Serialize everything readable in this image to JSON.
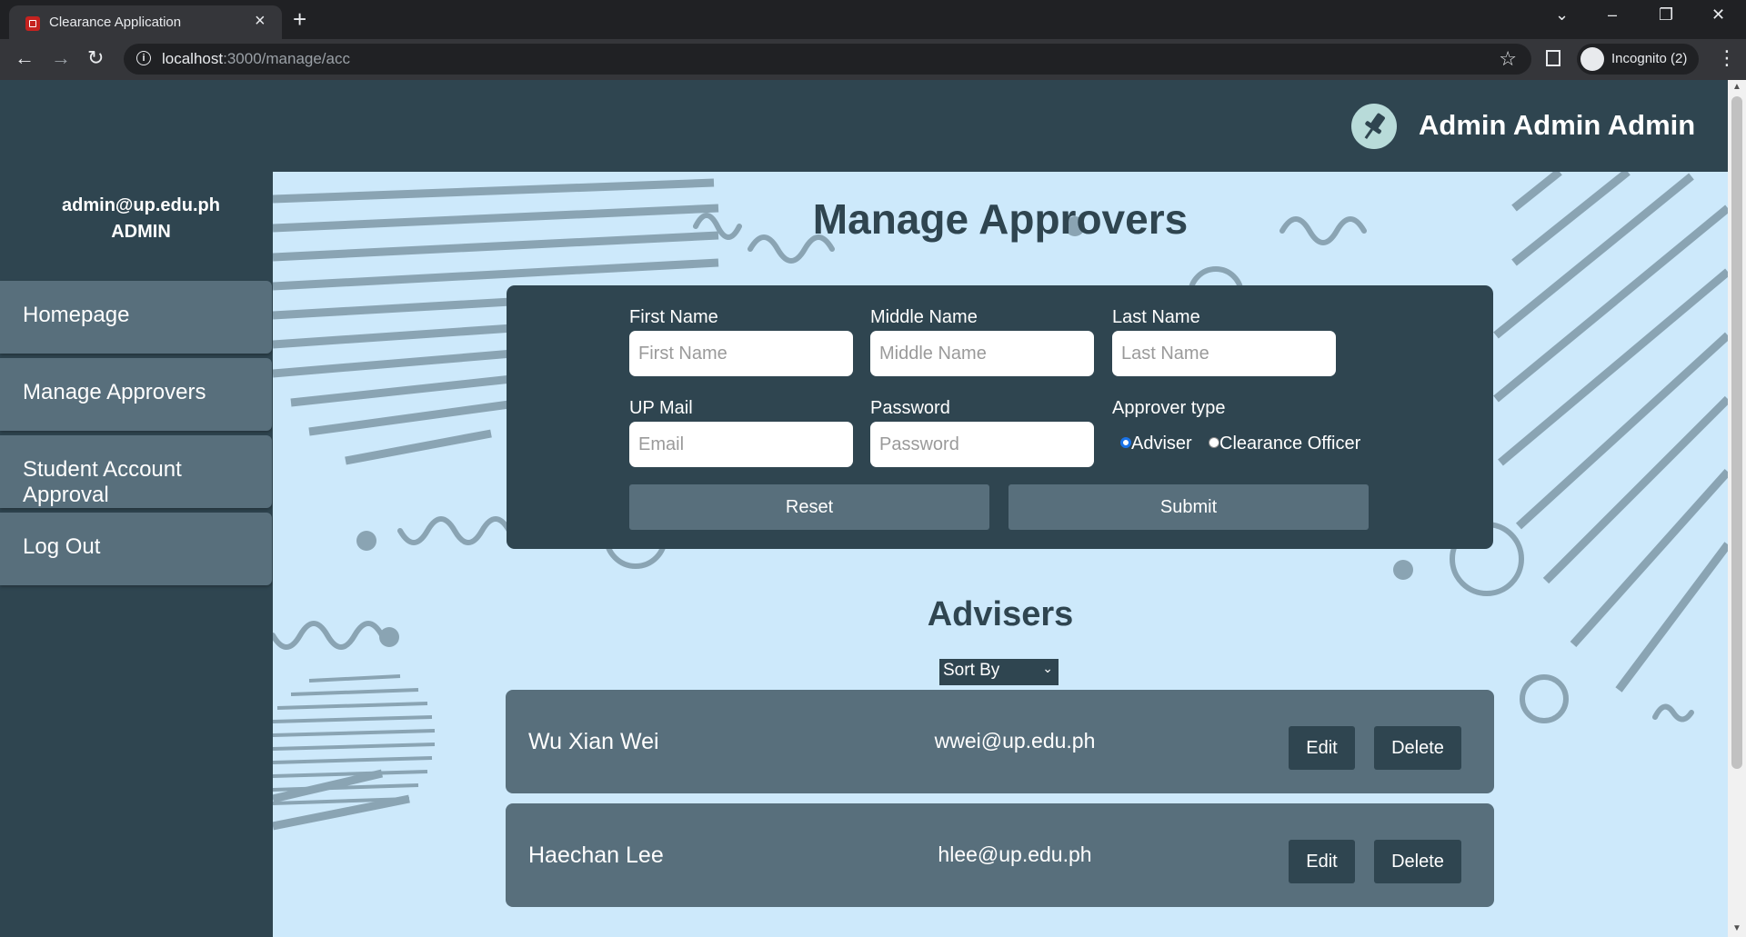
{
  "browser": {
    "tab_title": "Clearance Application",
    "url_host": "localhost",
    "url_rest": ":3000/manage/acc",
    "incognito_label": "Incognito (2)"
  },
  "header": {
    "user_name": "Admin Admin Admin"
  },
  "sidebar": {
    "email": "admin@up.edu.ph",
    "role": "ADMIN",
    "items": [
      {
        "label": "Homepage"
      },
      {
        "label": "Manage Approvers"
      },
      {
        "label": "Student Account Approval"
      },
      {
        "label": "Log Out"
      }
    ]
  },
  "main": {
    "title": "Manage Approvers",
    "form": {
      "first_name_label": "First Name",
      "first_name_placeholder": "First Name",
      "middle_name_label": "Middle Name",
      "middle_name_placeholder": "Middle Name",
      "last_name_label": "Last Name",
      "last_name_placeholder": "Last Name",
      "upmail_label": "UP Mail",
      "upmail_placeholder": "Email",
      "password_label": "Password",
      "password_placeholder": "Password",
      "approver_type_label": "Approver type",
      "approver_options": [
        {
          "label": "Adviser",
          "selected": true
        },
        {
          "label": "Clearance Officer",
          "selected": false
        }
      ],
      "reset_label": "Reset",
      "submit_label": "Submit"
    },
    "advisers_title": "Advisers",
    "sort_label": "Sort By",
    "advisers": [
      {
        "name": "Wu Xian Wei",
        "email": "wwei@up.edu.ph",
        "edit": "Edit",
        "delete": "Delete"
      },
      {
        "name": "Haechan Lee",
        "email": "hlee@up.edu.ph",
        "edit": "Edit",
        "delete": "Delete"
      }
    ]
  },
  "colors": {
    "dark": "#2f4550",
    "mid": "#586f7c",
    "light_bg": "#cde9fb",
    "deco": "#8aa4b3"
  }
}
